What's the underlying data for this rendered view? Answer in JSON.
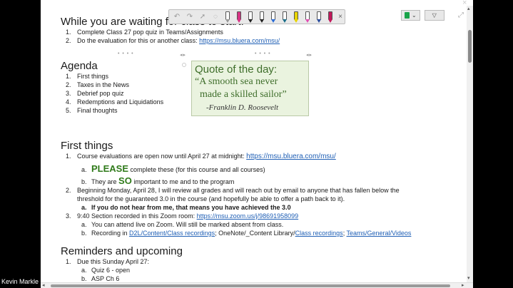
{
  "participant": {
    "name": "Kevin Markle"
  },
  "toolbar": {
    "undo_icon": "undo-icon",
    "redo_icon": "redo-icon",
    "select_icon": "cursor-icon",
    "pens": [
      "#ffffff",
      "#d63384",
      "#222222",
      "#222222",
      "#2b6cd6",
      "#1c6f8a",
      "#e8d400",
      "#e24fb3",
      "#2b4ea0",
      "#c2185b"
    ],
    "close_label": "×"
  },
  "right_buttons": {
    "dropdown_label": "⌄",
    "filter_label": "▽"
  },
  "waiting": {
    "heading": "While you are waiting for class to start:",
    "items": [
      {
        "num": "1.",
        "text": "Complete Class 27 pop quiz in Teams/Assignments"
      },
      {
        "num": "2.",
        "text": "Do the evaluation for this or another class: ",
        "link": "https://msu.bluera.com/msu/"
      }
    ]
  },
  "agenda": {
    "heading": "Agenda",
    "items": [
      {
        "num": "1.",
        "text": "First things"
      },
      {
        "num": "2.",
        "text": "Taxes in the News"
      },
      {
        "num": "3.",
        "text": "Debrief pop quiz"
      },
      {
        "num": "4.",
        "text": "Redemptions and Liquidations"
      },
      {
        "num": "5.",
        "text": "Final thoughts"
      }
    ]
  },
  "quote": {
    "title": "Quote of the day:",
    "line1": "“A smooth sea never",
    "line2": "made a skilled sailor”",
    "author": "-Franklin D. Roosevelt"
  },
  "first_things": {
    "heading": "First things",
    "item1": {
      "num": "1.",
      "text": "Course evaluations are open now until April 27 at midnight: ",
      "link": "https://msu.bluera.com/msu/"
    },
    "item1a": {
      "num": "a.",
      "big": "PLEASE",
      "text": " complete these (for this course and all courses)"
    },
    "item1b": {
      "num": "b.",
      "pre": "They are ",
      "big": "SO",
      "text": " important to me and to the program"
    },
    "item2": {
      "num": "2.",
      "line1": "Beginning Monday, April 28, I will review all grades and will reach out by email to anyone that has fallen below the",
      "line2": "threshold for the guaranteed 3.0 in the course (and hopefully be able to offer a path back to it)."
    },
    "item2a": {
      "num": "a.",
      "text": "If you do not hear from me, that means you have achieved the 3.0"
    },
    "item3": {
      "num": "3.",
      "text": "9:40 Section recorded in this Zoom room: ",
      "link": "https://msu.zoom.us/j/98691958099"
    },
    "item3a": {
      "num": "a.",
      "text": "You can attend live on Zoom. Will still be marked absent from class."
    },
    "item3b": {
      "num": "b.",
      "pre": "Recording in ",
      "link1": "D2L/Content/Class recordings",
      "mid": "; OneNote/_Content Library/",
      "link2": "Class recordings",
      "sep": "; ",
      "link3": "Teams/General/Videos"
    }
  },
  "reminders": {
    "heading": "Reminders and upcoming",
    "item1": {
      "num": "1.",
      "text": "Due this Sunday April 27:"
    },
    "item1a": {
      "num": "a.",
      "text": "Quiz 6 - open"
    },
    "item1b": {
      "num": "b.",
      "text": "ASP Ch 6"
    }
  }
}
